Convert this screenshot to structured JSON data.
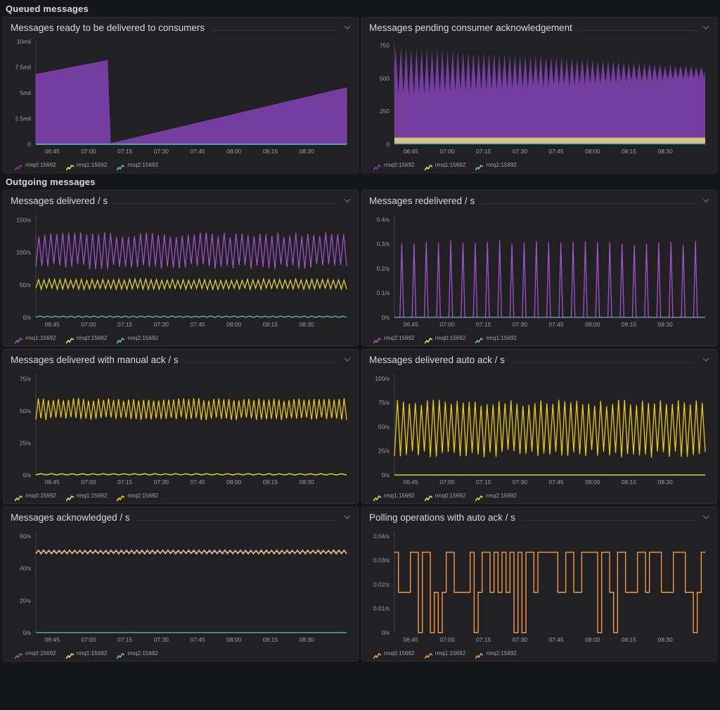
{
  "dashboard": {
    "background": "#161719",
    "panel_background": "#212124",
    "series_colors": {
      "purple": "#7b3fa8",
      "purple_line": "#a352cc",
      "yellow": "#eeda73",
      "yellow_line": "#e5d53a",
      "gold": "#f2cc0c",
      "cyan": "#5fc2c6",
      "orange": "#f2994a"
    }
  },
  "rows": [
    {
      "title": "Queued messages",
      "panels": [
        {
          "title": "Messages ready to be delivered to consumers",
          "collapse_icon": "chevron-down-icon",
          "legend": [
            {
              "label": "rmq0:15692",
              "color": "#7b3fa8",
              "icon": "area-series-icon"
            },
            {
              "label": "rmq1:15692",
              "color": "#eeda73",
              "icon": "area-series-icon"
            },
            {
              "label": "rmq2:15692",
              "color": "#5fc2c6",
              "icon": "area-series-icon"
            }
          ],
          "chart_data": {
            "type": "area",
            "title": "Messages ready to be delivered to consumers",
            "xlabel": "",
            "ylabel": "",
            "ylim": [
              0,
              10000000
            ],
            "yticks": [
              "0",
              "2.5mil",
              "5mil",
              "7.5mil",
              "10mil"
            ],
            "ytick_values": [
              0,
              2500000,
              5000000,
              7500000,
              10000000
            ],
            "xticks": [
              "06:45",
              "07:00",
              "07:15",
              "07:30",
              "07:45",
              "08:00",
              "08:15",
              "08:30"
            ],
            "grid": false,
            "legend_position": "bottom",
            "series": [
              {
                "name": "rmq0:15692",
                "color": "#7b3fa8",
                "x": [
                  0,
                  0.23,
                  0.24,
                  1.0
                ],
                "values": [
                  6800000,
                  8150000,
                  60000,
                  5500000
                ]
              },
              {
                "name": "rmq1:15692",
                "color": "#eeda73",
                "x": [
                  0,
                  1.0
                ],
                "values": [
                  0,
                  0
                ]
              },
              {
                "name": "rmq2:15692",
                "color": "#5fc2c6",
                "x": [
                  0,
                  1.0
                ],
                "values": [
                  0,
                  0
                ]
              }
            ]
          }
        },
        {
          "title": "Messages pending consumer acknowledgement",
          "collapse_icon": "chevron-down-icon",
          "legend": [
            {
              "label": "rmq0:15692",
              "color": "#7b3fa8",
              "icon": "area-series-icon"
            },
            {
              "label": "rmq1:15692",
              "color": "#eeda73",
              "icon": "area-series-icon"
            },
            {
              "label": "rmq2:15692",
              "color": "#5fc2c6",
              "icon": "area-series-icon"
            }
          ],
          "chart_data": {
            "type": "area",
            "title": "Messages pending consumer acknowledgement",
            "xlabel": "",
            "ylabel": "",
            "ylim": [
              0,
              780
            ],
            "yticks": [
              "0",
              "250",
              "500",
              "750"
            ],
            "ytick_values": [
              0,
              250,
              500,
              750
            ],
            "xticks": [
              "06:45",
              "07:00",
              "07:15",
              "07:30",
              "07:45",
              "08:00",
              "08:15",
              "08:30"
            ],
            "grid": false,
            "legend_position": "bottom",
            "note": "Oscillating sawtooth with decaying amplitude: peaks fall from ~700 to ~540, troughs rise from ~330 to ~470; stacked tan band ~40 and cyan band ~8 at the base.",
            "series": [
              {
                "name": "rmq0:15692",
                "color": "#7b3fa8",
                "peak_start": 700,
                "peak_end": 545,
                "trough_start": 330,
                "trough_end": 470,
                "cycles": 60
              },
              {
                "name": "rmq1:15692",
                "color": "#eeda73",
                "band_value": 40
              },
              {
                "name": "rmq2:15692",
                "color": "#5fc2c6",
                "band_value": 10
              }
            ]
          }
        }
      ]
    },
    {
      "title": "Outgoing messages",
      "panels": [
        {
          "title": "Messages delivered / s",
          "collapse_icon": "chevron-down-icon",
          "legend": [
            {
              "label": "rmq1:15692",
              "color": "#a352cc",
              "icon": "line-series-icon"
            },
            {
              "label": "rmq0:15692",
              "color": "#eeda73",
              "icon": "line-series-icon"
            },
            {
              "label": "rmq2:15692",
              "color": "#5fc2c6",
              "icon": "line-series-icon"
            }
          ],
          "chart_data": {
            "type": "line",
            "title": "Messages delivered / s",
            "ylim": [
              0,
              158
            ],
            "yticks": [
              "0/s",
              "50/s",
              "100/s",
              "150/s"
            ],
            "ytick_values": [
              0,
              50,
              100,
              150
            ],
            "xticks": [
              "06:45",
              "07:00",
              "07:15",
              "07:30",
              "07:45",
              "08:00",
              "08:15",
              "08:30"
            ],
            "grid": false,
            "legend_position": "bottom",
            "series": [
              {
                "name": "rmq1:15692",
                "color": "#a352cc",
                "min": 78,
                "max": 127,
                "cycles": 52
              },
              {
                "name": "rmq0:15692",
                "color": "#e5d53a",
                "min": 44,
                "max": 58,
                "cycles": 58
              },
              {
                "name": "rmq2:15692",
                "color": "#5fc2c6",
                "min": 0,
                "max": 2,
                "cycles": 40
              }
            ]
          }
        },
        {
          "title": "Messages redelivered / s",
          "collapse_icon": "chevron-down-icon",
          "legend": [
            {
              "label": "rmq2:15692",
              "color": "#a352cc",
              "icon": "line-series-icon"
            },
            {
              "label": "rmq0:15692",
              "color": "#eeda73",
              "icon": "line-series-icon"
            },
            {
              "label": "rmq1:15692",
              "color": "#5fc2c6",
              "icon": "line-series-icon"
            }
          ],
          "chart_data": {
            "type": "line",
            "title": "Messages redelivered / s",
            "ylim": [
              0,
              0.42
            ],
            "yticks": [
              "0/s",
              "0.1/s",
              "0.2/s",
              "0.3/s",
              "0.4/s"
            ],
            "ytick_values": [
              0,
              0.1,
              0.2,
              0.3,
              0.4
            ],
            "xticks": [
              "06:45",
              "07:00",
              "07:15",
              "07:30",
              "07:45",
              "08:00",
              "08:15",
              "08:30"
            ],
            "grid": false,
            "legend_position": "bottom",
            "note": "Narrow isolated spikes from 0 up to ~0.30-0.32/s, roughly 25 spikes across the window.",
            "series": [
              {
                "name": "rmq2:15692",
                "color": "#a352cc",
                "spike_peak": 0.315,
                "spike_count": 25,
                "baseline": 0
              },
              {
                "name": "rmq0:15692",
                "color": "#eeda73",
                "baseline": 0
              },
              {
                "name": "rmq1:15692",
                "color": "#5fc2c6",
                "baseline": 0
              }
            ]
          }
        }
      ]
    },
    {
      "title": "",
      "panels": [
        {
          "title": "Messages delivered with manual ack / s",
          "collapse_icon": "chevron-down-icon",
          "legend": [
            {
              "label": "rmq0:15692",
              "color": "#e5d53a",
              "icon": "line-series-icon"
            },
            {
              "label": "rmq1:15692",
              "color": "#eeda73",
              "icon": "line-series-icon"
            },
            {
              "label": "rmq2:15692",
              "color": "#f2cc0c",
              "icon": "line-series-icon"
            }
          ],
          "chart_data": {
            "type": "line",
            "title": "Messages delivered with manual ack / s",
            "ylim": [
              0,
              79
            ],
            "yticks": [
              "0/s",
              "25/s",
              "50/s",
              "75/s"
            ],
            "ytick_values": [
              0,
              25,
              50,
              75
            ],
            "xticks": [
              "06:45",
              "07:00",
              "07:15",
              "07:30",
              "07:45",
              "08:00",
              "08:15",
              "08:30"
            ],
            "grid": false,
            "legend_position": "bottom",
            "series": [
              {
                "name": "rmq0:15692",
                "color": "#f2cc0c",
                "min": 44,
                "max": 59,
                "cycles": 62
              },
              {
                "name": "rmq1:15692",
                "color": "#eeda73",
                "min": 0,
                "max": 1,
                "cycles": 30
              },
              {
                "name": "rmq2:15692",
                "color": "#e5d53a",
                "min": 0,
                "max": 1,
                "cycles": 30
              }
            ]
          }
        },
        {
          "title": "Messages delivered auto ack / s",
          "collapse_icon": "chevron-down-icon",
          "legend": [
            {
              "label": "rmq1:15692",
              "color": "#e5d53a",
              "icon": "line-series-icon"
            },
            {
              "label": "rmq0:15692",
              "color": "#eeda73",
              "icon": "line-series-icon"
            },
            {
              "label": "rmq2:15692",
              "color": "#f2cc0c",
              "icon": "line-series-icon"
            }
          ],
          "chart_data": {
            "type": "line",
            "title": "Messages delivered auto ack / s",
            "ylim": [
              0,
              105
            ],
            "yticks": [
              "0/s",
              "25/s",
              "50/s",
              "75/s",
              "100/s"
            ],
            "ytick_values": [
              0,
              25,
              50,
              75,
              100
            ],
            "xticks": [
              "06:45",
              "07:00",
              "07:15",
              "07:30",
              "07:45",
              "08:00",
              "08:15",
              "08:30"
            ],
            "grid": false,
            "legend_position": "bottom",
            "series": [
              {
                "name": "rmq1:15692",
                "color": "#f2cc0c",
                "min": 22,
                "max": 74,
                "cycles": 52
              },
              {
                "name": "rmq0:15692",
                "color": "#eeda73",
                "baseline": 0
              },
              {
                "name": "rmq2:15692",
                "color": "#e5d53a",
                "baseline": 0
              }
            ]
          }
        }
      ]
    },
    {
      "title": "",
      "panels": [
        {
          "title": "Messages acknowledged / s",
          "collapse_icon": "chevron-down-icon",
          "legend": [
            {
              "label": "rmq0:15692",
              "color": "#a352cc",
              "icon": "line-series-icon"
            },
            {
              "label": "rmq1:15692",
              "color": "#eeda73",
              "icon": "line-series-icon"
            },
            {
              "label": "rmq2:15692",
              "color": "#5fc2c6",
              "icon": "line-series-icon"
            }
          ],
          "chart_data": {
            "type": "line",
            "title": "Messages acknowledged / s",
            "ylim": [
              0,
              63
            ],
            "yticks": [
              "0/s",
              "20/s",
              "40/s",
              "60/s"
            ],
            "ytick_values": [
              0,
              20,
              40,
              60
            ],
            "xticks": [
              "06:45",
              "07:00",
              "07:15",
              "07:30",
              "07:45",
              "08:00",
              "08:15",
              "08:30"
            ],
            "grid": false,
            "legend_position": "bottom",
            "note": "Two nearly flat overlapping traces around 50/s with small ripple; dip to ~48 near 07:30. Cyan series flat at 0.",
            "series": [
              {
                "name": "rmq0:15692",
                "color": "#a352cc",
                "min": 49.5,
                "max": 51.5,
                "cycles": 60
              },
              {
                "name": "rmq1:15692",
                "color": "#eeda73",
                "min": 49,
                "max": 51,
                "cycles": 60
              },
              {
                "name": "rmq2:15692",
                "color": "#5fc2c6",
                "baseline": 0
              }
            ]
          }
        },
        {
          "title": "Polling operations with auto ack / s",
          "collapse_icon": "chevron-down-icon",
          "legend": [
            {
              "label": "rmq0:15692",
              "color": "#f2994a",
              "icon": "line-series-icon"
            },
            {
              "label": "rmq1:15692",
              "color": "#f2994a",
              "icon": "line-series-icon"
            },
            {
              "label": "rmq2:15692",
              "color": "#f2994a",
              "icon": "line-series-icon"
            }
          ],
          "chart_data": {
            "type": "line",
            "title": "Polling operations with auto ack / s",
            "ylim": [
              0,
              0.042
            ],
            "yticks": [
              "0/s",
              "0.01/s",
              "0.02/s",
              "0.03/s",
              "0.04/s"
            ],
            "ytick_values": [
              0,
              0.01,
              0.02,
              0.03,
              0.04
            ],
            "xticks": [
              "06:45",
              "07:00",
              "07:15",
              "07:30",
              "07:45",
              "08:00",
              "08:15",
              "08:30"
            ],
            "grid": false,
            "legend_position": "bottom",
            "note": "Square-wave stepping mostly between 0.0167/s and 0.0333/s with occasional drops to 0/s.",
            "series": [
              {
                "name": "rmq0:15692",
                "color": "#f2994a",
                "levels": [
                  0,
                  0.0167,
                  0.0333
                ],
                "high": 0.0333,
                "mid": 0.0167,
                "low": 0
              }
            ]
          }
        }
      ]
    }
  ]
}
